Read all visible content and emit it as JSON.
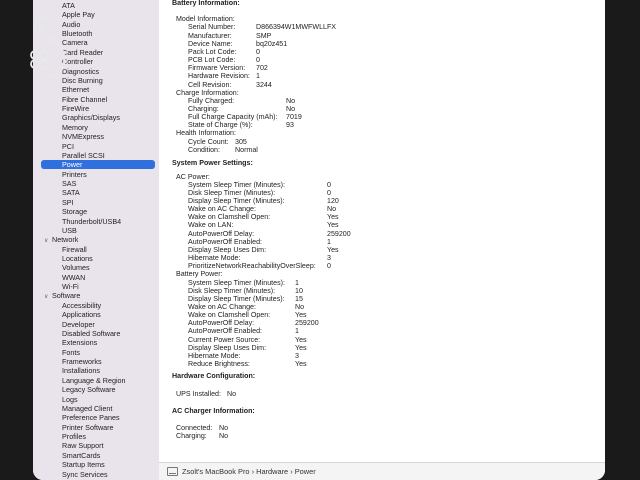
{
  "sidebar": {
    "items_top": [
      "ATA",
      "Apple Pay",
      "Audio",
      "Bluetooth",
      "Camera",
      "Card Reader",
      "Controller",
      "Diagnostics",
      "Disc Burning",
      "Ethernet",
      "Fibre Channel",
      "FireWire",
      "Graphics/Displays",
      "Memory",
      "NVMExpress",
      "PCI",
      "Parallel SCSI",
      "Power",
      "Printers",
      "SAS",
      "SATA",
      "SPI",
      "Storage",
      "Thunderbolt/USB4",
      "USB"
    ],
    "selected": "Power",
    "network_label": "Network",
    "network_items": [
      "Firewall",
      "Locations",
      "Volumes",
      "WWAN",
      "Wi-Fi"
    ],
    "software_label": "Software",
    "software_items": [
      "Accessibility",
      "Applications",
      "Developer",
      "Disabled Software",
      "Extensions",
      "Fonts",
      "Frameworks",
      "Installations",
      "Language & Region",
      "Legacy Software",
      "Logs",
      "Managed Client",
      "Preference Panes",
      "Printer Software",
      "Profiles",
      "Raw Support",
      "SmartCards",
      "Startup Items",
      "Sync Services"
    ]
  },
  "content": {
    "battery_title": "Battery Information:",
    "model_info_label": "Model Information:",
    "model_info": [
      {
        "k": "Serial Number:",
        "v": "D866394W1MWFWLLFX"
      },
      {
        "k": "Manufacturer:",
        "v": "SMP"
      },
      {
        "k": "Device Name:",
        "v": "bq20z451"
      },
      {
        "k": "Pack Lot Code:",
        "v": "0"
      },
      {
        "k": "PCB Lot Code:",
        "v": "0"
      },
      {
        "k": "Firmware Version:",
        "v": "702"
      },
      {
        "k": "Hardware Revision:",
        "v": "1"
      },
      {
        "k": "Cell Revision:",
        "v": "3244"
      }
    ],
    "charge_info_label": "Charge Information:",
    "charge_info": [
      {
        "k": "Fully Charged:",
        "v": "No"
      },
      {
        "k": "Charging:",
        "v": "No"
      },
      {
        "k": "Full Charge Capacity (mAh):",
        "v": "7019"
      },
      {
        "k": "State of Charge (%):",
        "v": "93"
      }
    ],
    "health_info_label": "Health Information:",
    "health_info": [
      {
        "k": "Cycle Count:",
        "v": "305"
      },
      {
        "k": "Condition:",
        "v": "Normal"
      }
    ],
    "sys_power_title": "System Power Settings:",
    "ac_power_label": "AC Power:",
    "ac_power": [
      {
        "k": "System Sleep Timer (Minutes):",
        "v": "0"
      },
      {
        "k": "Disk Sleep Timer (Minutes):",
        "v": "0"
      },
      {
        "k": "Display Sleep Timer (Minutes):",
        "v": "120"
      },
      {
        "k": "Wake on AC Change:",
        "v": "No"
      },
      {
        "k": "Wake on Clamshell Open:",
        "v": "Yes"
      },
      {
        "k": "Wake on LAN:",
        "v": "Yes"
      },
      {
        "k": "AutoPowerOff Delay:",
        "v": "259200"
      },
      {
        "k": "AutoPowerOff Enabled:",
        "v": "1"
      },
      {
        "k": "Display Sleep Uses Dim:",
        "v": "Yes"
      },
      {
        "k": "Hibernate Mode:",
        "v": "3"
      },
      {
        "k": "PrioritizeNetworkReachabilityOverSleep:",
        "v": "0"
      }
    ],
    "battery_power_label": "Battery Power:",
    "battery_power": [
      {
        "k": "System Sleep Timer (Minutes):",
        "v": "1"
      },
      {
        "k": "Disk Sleep Timer (Minutes):",
        "v": "10"
      },
      {
        "k": "Display Sleep Timer (Minutes):",
        "v": "15"
      },
      {
        "k": "Wake on AC Change:",
        "v": "No"
      },
      {
        "k": "Wake on Clamshell Open:",
        "v": "Yes"
      },
      {
        "k": "AutoPowerOff Delay:",
        "v": "259200"
      },
      {
        "k": "AutoPowerOff Enabled:",
        "v": "1"
      },
      {
        "k": "Current Power Source:",
        "v": "Yes"
      },
      {
        "k": "Display Sleep Uses Dim:",
        "v": "Yes"
      },
      {
        "k": "Hibernate Mode:",
        "v": "3"
      },
      {
        "k": "Reduce Brightness:",
        "v": "Yes"
      }
    ],
    "hw_config_title": "Hardware Configuration:",
    "ups_label": "UPS Installed:",
    "ups_value": "No",
    "ac_charger_title": "AC Charger Information:",
    "ac_charger": [
      {
        "k": "Connected:",
        "v": "No"
      },
      {
        "k": "Charging:",
        "v": "No"
      }
    ]
  },
  "statusbar": {
    "path": "Zsolt's MacBook Pro › Hardware › Power"
  }
}
